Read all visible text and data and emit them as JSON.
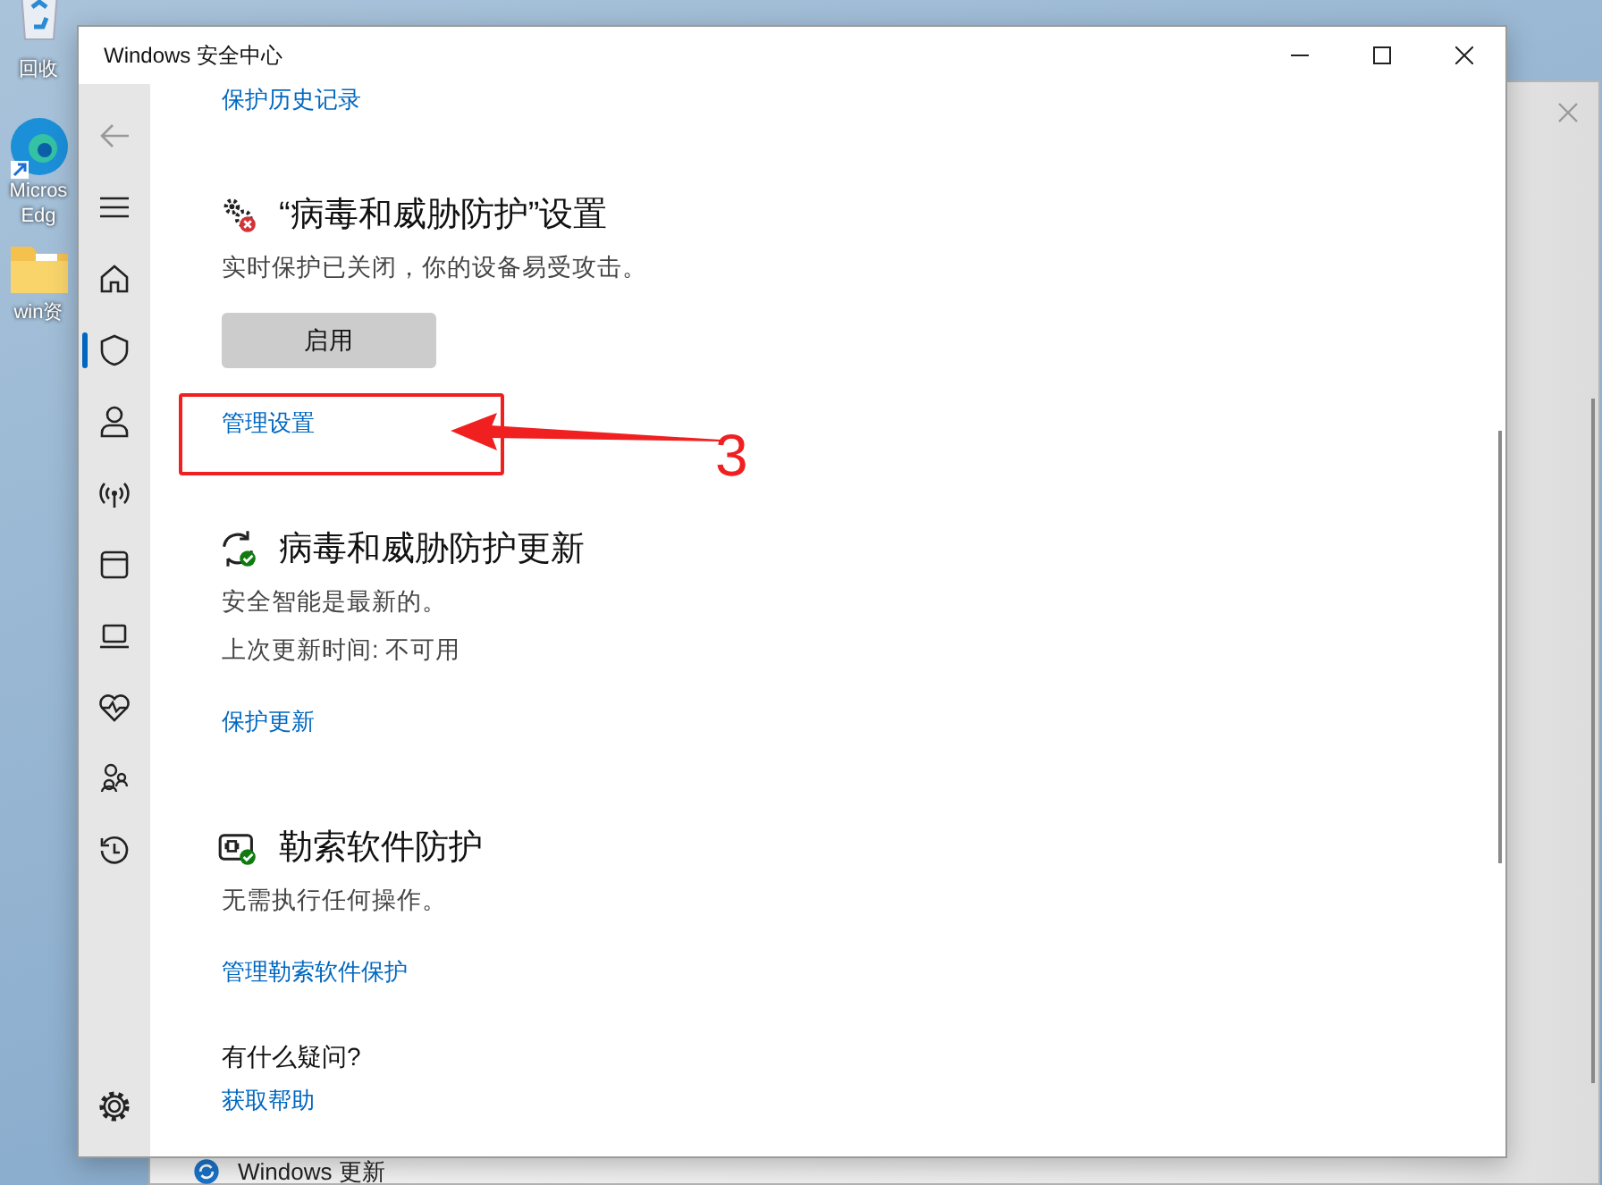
{
  "desktop_icons": [
    {
      "kind": "recycle-bin",
      "label": "回收"
    },
    {
      "kind": "browser",
      "label": "Micros Edg"
    },
    {
      "kind": "folder",
      "label": "win资"
    }
  ],
  "background_window": {
    "item_label": "Windows 更新"
  },
  "window": {
    "title": "Windows 安全中心"
  },
  "sidebar": {
    "items": [
      {
        "kind": "back",
        "selected": false
      },
      {
        "kind": "menu",
        "selected": false
      },
      {
        "kind": "home",
        "selected": false
      },
      {
        "kind": "shield",
        "selected": true
      },
      {
        "kind": "account",
        "selected": false
      },
      {
        "kind": "network",
        "selected": false
      },
      {
        "kind": "app",
        "selected": false
      },
      {
        "kind": "device",
        "selected": false
      },
      {
        "kind": "health",
        "selected": false
      },
      {
        "kind": "family",
        "selected": false
      },
      {
        "kind": "history",
        "selected": false
      },
      {
        "kind": "settings",
        "selected": false
      }
    ]
  },
  "top_link": "保护历史记录",
  "sections": [
    {
      "kind": "settings-warning",
      "title": "“病毒和威胁防护”设置",
      "lines": [
        "实时保护已关闭，你的设备易受攻击。"
      ],
      "button": "启用",
      "link": "管理设置"
    },
    {
      "kind": "update-ok",
      "title": "病毒和威胁防护更新",
      "lines": [
        "安全智能是最新的。",
        "上次更新时间: 不可用"
      ],
      "link": "保护更新"
    },
    {
      "kind": "ransomware-ok",
      "title": "勒索软件防护",
      "lines": [
        "无需执行任何操作。"
      ],
      "link": "管理勒索软件保护"
    }
  ],
  "help": {
    "title": "有什么疑问?",
    "link": "获取帮助"
  },
  "annotation": {
    "label": "3"
  }
}
